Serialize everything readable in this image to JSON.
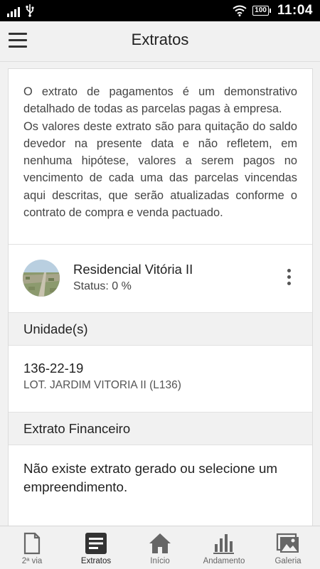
{
  "statusbar": {
    "battery": "100",
    "time": "11:04"
  },
  "appbar": {
    "title": "Extratos"
  },
  "intro": {
    "paragraph1": "O extrato de pagamentos é um demonstrativo detalhado de todas as parcelas pagas à empresa.",
    "paragraph2": "Os valores deste extrato são para quitação do saldo devedor na presente data e não refletem, em nenhuma hipótese, valores a serem pagos no vencimento de cada uma das parcelas vincendas aqui descritas, que serão atualizadas conforme o contrato de compra e venda pactuado."
  },
  "project": {
    "name": "Residencial Vitória II",
    "status": "Status: 0 %"
  },
  "units": {
    "header": "Unidade(s)",
    "code": "136-22-19",
    "name": "LOT. JARDIM VITORIA II (L136)"
  },
  "financial": {
    "header": "Extrato Financeiro",
    "empty_message": "Não existe extrato gerado ou selecione um empreendimento."
  },
  "nav": {
    "items": [
      {
        "label": "2ª via",
        "icon": "document-icon"
      },
      {
        "label": "Extratos",
        "icon": "list-document-icon"
      },
      {
        "label": "Início",
        "icon": "home-icon"
      },
      {
        "label": "Andamento",
        "icon": "bar-chart-icon"
      },
      {
        "label": "Galeria",
        "icon": "gallery-icon"
      }
    ],
    "active": 1
  },
  "colors": {
    "background": "#f1f1f1",
    "card": "#ffffff",
    "icon": "#555555",
    "active_icon": "#333333"
  }
}
